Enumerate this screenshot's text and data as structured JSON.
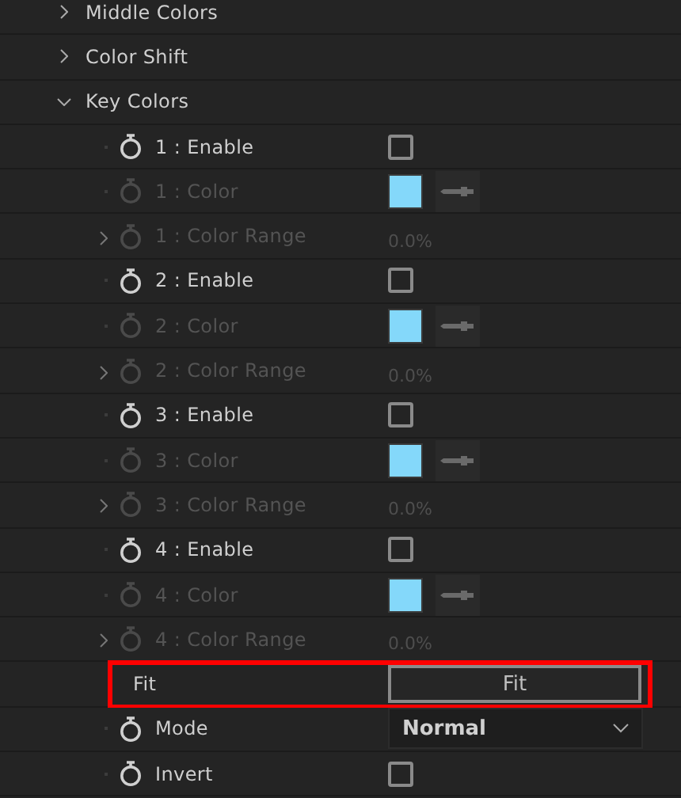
{
  "properties": [
    {
      "kind": "group",
      "label": "Middle Colors",
      "expanded": false
    },
    {
      "kind": "group",
      "label": "Color Shift",
      "expanded": false
    },
    {
      "kind": "group",
      "label": "Key Colors",
      "expanded": true,
      "children": [
        {
          "kind": "checkbox",
          "label": "1 : Enable",
          "checked": false,
          "disabled": false
        },
        {
          "kind": "color",
          "label": "1 : Color",
          "color": "#84d8fa",
          "disabled": true
        },
        {
          "kind": "range",
          "label": "1 : Color Range",
          "value": "0.0%",
          "expanded": false,
          "disabled": true
        },
        {
          "kind": "checkbox",
          "label": "2 : Enable",
          "checked": false,
          "disabled": false
        },
        {
          "kind": "color",
          "label": "2 : Color",
          "color": "#84d8fa",
          "disabled": true
        },
        {
          "kind": "range",
          "label": "2 : Color Range",
          "value": "0.0%",
          "expanded": false,
          "disabled": true
        },
        {
          "kind": "checkbox",
          "label": "3 : Enable",
          "checked": false,
          "disabled": false
        },
        {
          "kind": "color",
          "label": "3 : Color",
          "color": "#84d8fa",
          "disabled": true
        },
        {
          "kind": "range",
          "label": "3 : Color Range",
          "value": "0.0%",
          "expanded": false,
          "disabled": true
        },
        {
          "kind": "checkbox",
          "label": "4 : Enable",
          "checked": false,
          "disabled": false
        },
        {
          "kind": "color",
          "label": "4 : Color",
          "color": "#84d8fa",
          "disabled": true
        },
        {
          "kind": "range",
          "label": "4 : Color Range",
          "value": "0.0%",
          "expanded": false,
          "disabled": true
        }
      ]
    },
    {
      "kind": "button",
      "label": "Fit",
      "button": "Fit",
      "highlighted": true
    },
    {
      "kind": "select",
      "label": "Mode",
      "value": "Normal",
      "disabled": false
    },
    {
      "kind": "checkbox",
      "label": "Invert",
      "checked": false,
      "disabled": false
    }
  ]
}
